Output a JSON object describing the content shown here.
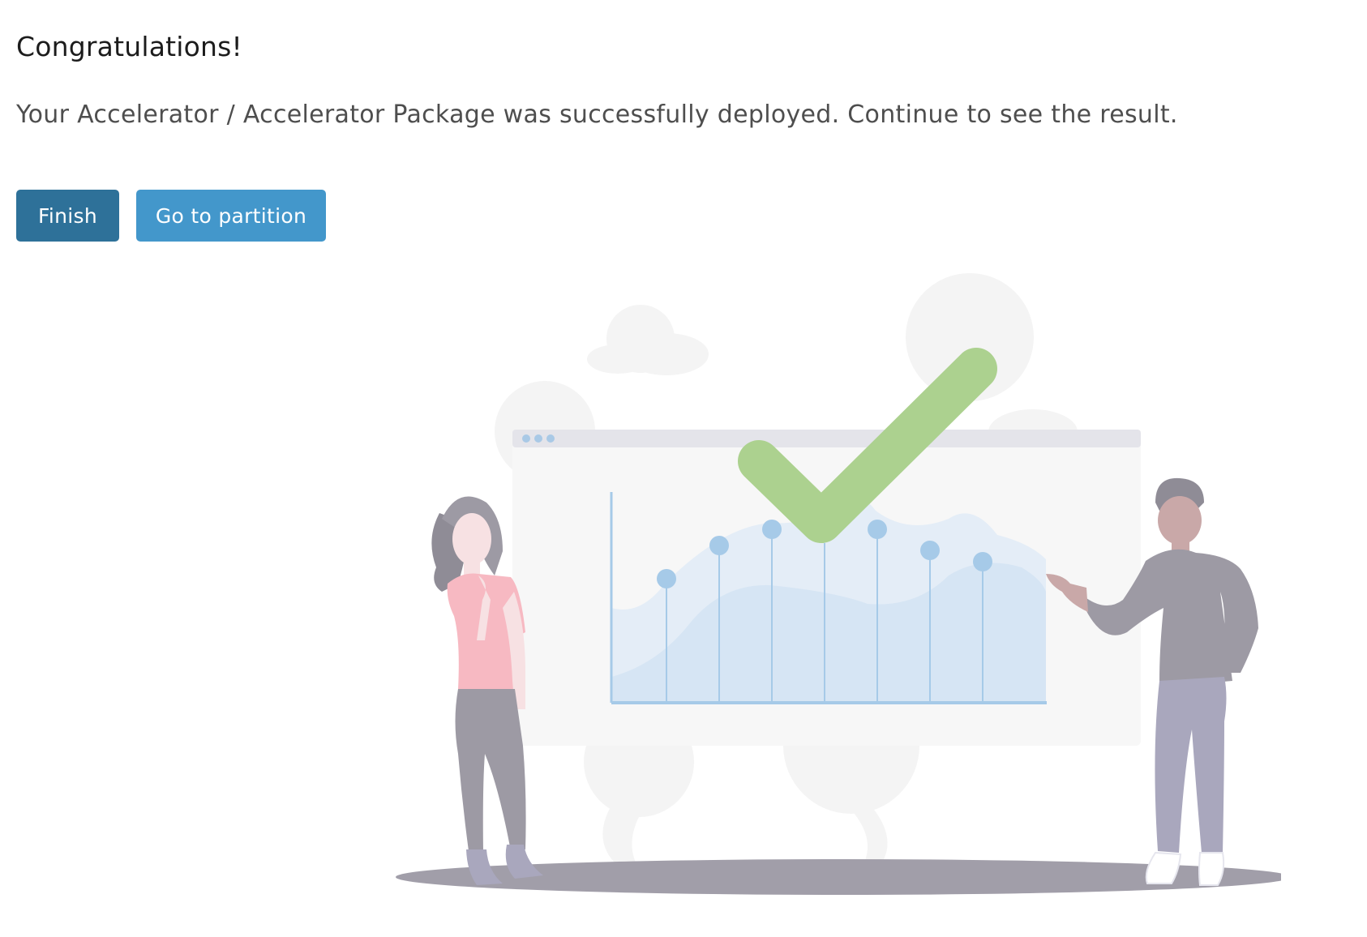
{
  "header": {
    "title": "Congratulations!"
  },
  "body": {
    "message": "Your Accelerator / Accelerator Package was successfully deployed. Continue to see the result."
  },
  "actions": {
    "finish_label": "Finish",
    "go_to_partition_label": "Go to partition"
  },
  "colors": {
    "primary_button": "#2e7199",
    "secondary_button": "#4397cb",
    "check_mark": "#acd18f",
    "chart_point": "#a6cae8"
  },
  "illustration": {
    "icon": "success-check-illustration"
  }
}
